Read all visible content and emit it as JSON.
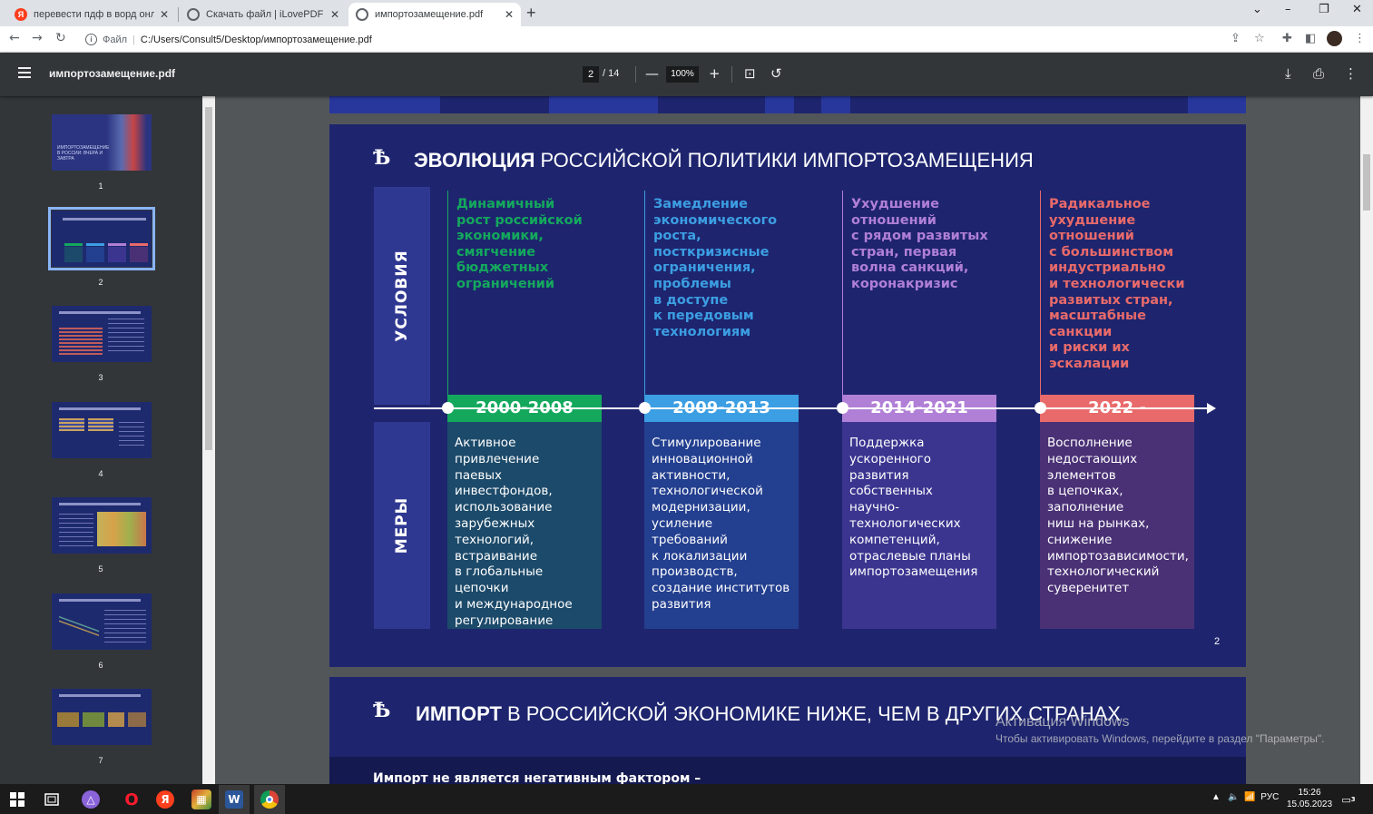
{
  "browser": {
    "tabs": [
      {
        "label": "перевести пдф в ворд онлайн",
        "favicon": "Я",
        "favicon_color": "#fc3f1d"
      },
      {
        "label": "Скачать файл | iLovePDF",
        "favicon": "",
        "favicon_color": "#5f6368"
      },
      {
        "label": "импортозамещение.pdf",
        "favicon": "",
        "favicon_color": "#5f6368"
      }
    ],
    "address": {
      "scheme": "Файл",
      "url": "C:/Users/Consult5/Desktop/импортозамещение.pdf"
    }
  },
  "pdf_toolbar": {
    "filename": "импортозамещение.pdf",
    "current_page": "2",
    "total_pages": "/ 14",
    "zoom": "100%"
  },
  "thumbnails": [
    {
      "num": "1",
      "preview_text": "ИМПОРТОЗАМЕЩЕНИЕ В РОССИИ: ВЧЕРА И ЗАВТРА"
    },
    {
      "num": "2"
    },
    {
      "num": "3"
    },
    {
      "num": "4"
    },
    {
      "num": "5"
    },
    {
      "num": "6"
    },
    {
      "num": "7"
    }
  ],
  "slide2": {
    "logo": "Ѣ",
    "title_bold": "ЭВОЛЮЦИЯ",
    "title_rest": " РОССИЙСКОЙ ПОЛИТИКИ ИМПОРТОЗАМЕЩЕНИЯ",
    "label_conditions": "УСЛОВИЯ",
    "label_measures": "МЕРЫ",
    "page_number": "2",
    "periods": [
      {
        "years": "2000-2008",
        "color": "#14a85d",
        "measure_bg": "#1c4a6a",
        "condition": "Динамичный\nрост российской\nэкономики,\nсмягчение\nбюджетных\nограничений",
        "measures": "Активное\nпривлечение\nпаевых\nинвестфондов,\nиспользование\nзарубежных\nтехнологий,\nвстраивание\nв глобальные цепочки\nи международное\nрегулирование"
      },
      {
        "years": "2009-2013",
        "color": "#3c9ee3",
        "measure_bg": "#233f8f",
        "condition": "Замедление\nэкономического\nроста,\nпосткризисные\nограничения,\nпроблемы\nв доступе\nк передовым\nтехнологиям",
        "measures": "Стимулирование\nинновационной\nактивности,\nтехнологической\nмодернизации,\nусиление требований\nк локализации\nпроизводств,\nсоздание институтов\nразвития"
      },
      {
        "years": "2014-2021",
        "color": "#b07fd6",
        "measure_bg": "#3b3590",
        "condition": "Ухудшение\nотношений\nс рядом развитых\nстран, первая\nволна санкций,\nкоронакризис",
        "measures": "Поддержка\nускоренного\nразвития\nсобственных\n научно-\nтехнологических\nкомпетенций,\nотраслевые планы\nимпортозамещения"
      },
      {
        "years": "2022 -",
        "color": "#e86a6a",
        "measure_bg": "#4a3176",
        "condition": "Радикальное\nухудшение\nотношений\nс большинством\nиндустриально\nи технологически\nразвитых стран,\nмасштабные\nсанкции\nи риски их\nэскалации",
        "measures": "Восполнение\nнедостающих\nэлементов\nв цепочках,\nзаполнение\nниш на рынках,\nснижение\nимпортозависимости,\nтехнологический\nсуверенитет"
      }
    ]
  },
  "slide3": {
    "logo": "Ѣ",
    "title_bold": "ИМПОРТ",
    "title_rest": " В РОССИЙСКОЙ ЭКОНОМИКЕ НИЖЕ, ЧЕМ В ДРУГИХ СТРАНАХ",
    "subtitle": "Импорт не является негативным фактором –"
  },
  "watermark": {
    "line1": "Активация Windows",
    "line2": "Чтобы активировать Windows, перейдите в раздел \"Параметры\"."
  },
  "taskbar": {
    "lang": "РУС",
    "time": "15:26",
    "date": "15.05.2023",
    "notifications": "3"
  }
}
